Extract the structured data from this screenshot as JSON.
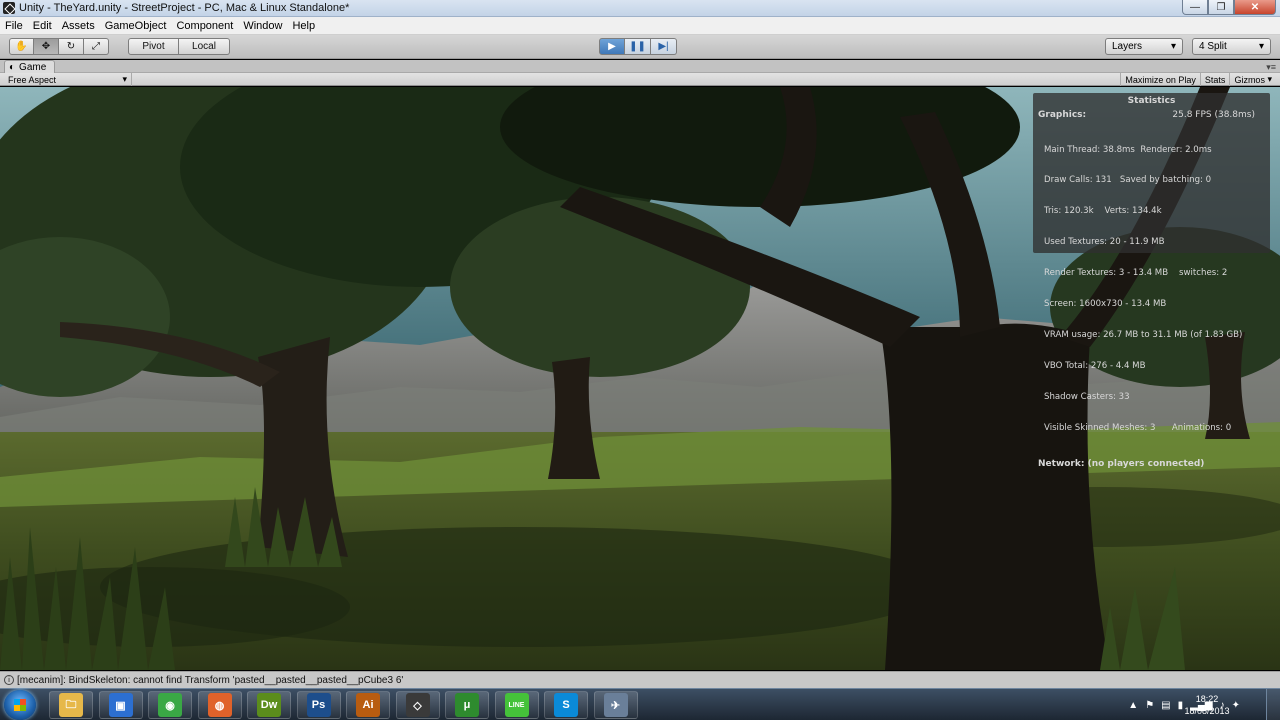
{
  "window": {
    "title": "Unity - TheYard.unity - StreetProject - PC, Mac & Linux Standalone*",
    "controls": {
      "minimize": "—",
      "maximize": "❐",
      "close": "✕"
    }
  },
  "menu": [
    "File",
    "Edit",
    "Assets",
    "GameObject",
    "Component",
    "Window",
    "Help"
  ],
  "toolbar": {
    "tools": [
      {
        "name": "hand-icon",
        "glyph": "✋"
      },
      {
        "name": "move-icon",
        "glyph": "✥"
      },
      {
        "name": "rotate-icon",
        "glyph": "↻"
      },
      {
        "name": "scale-icon",
        "glyph": "⤢"
      }
    ],
    "pivot_label": "Pivot",
    "local_label": "Local",
    "play": {
      "play": "▶",
      "pause": "❚❚",
      "step": "▶|"
    },
    "layers_label": "Layers",
    "layout_label": "4 Split"
  },
  "game_panel": {
    "tab_label": "Game",
    "aspect_label": "Free Aspect",
    "maximize_label": "Maximize on Play",
    "stats_label": "Stats",
    "gizmos_label": "Gizmos"
  },
  "statistics": {
    "title": "Statistics",
    "graphics_label": "Graphics:",
    "fps": "25.8 FPS (38.8ms)",
    "lines": [
      "Main Thread: 38.8ms  Renderer: 2.0ms",
      "Draw Calls: 131   Saved by batching: 0",
      "Tris: 120.3k    Verts: 134.4k",
      "Used Textures: 20 - 11.9 MB",
      "Render Textures: 3 - 13.4 MB    switches: 2",
      "Screen: 1600x730 - 13.4 MB",
      "VRAM usage: 26.7 MB to 31.1 MB (of 1.83 GB)",
      "VBO Total: 276 - 4.4 MB",
      "Shadow Casters: 33",
      "Visible Skinned Meshes: 3      Animations: 0"
    ],
    "network": "Network: (no players connected)"
  },
  "console_message": "[mecanim]: BindSkeleton: cannot find Transform 'pasted__pasted__pasted__pCube3 6'",
  "taskbar": {
    "apps": [
      {
        "name": "explorer",
        "glyph": "🗀",
        "color": "#e6b84a"
      },
      {
        "name": "app-blue",
        "glyph": "▣",
        "color": "#2c6fd1"
      },
      {
        "name": "chrome",
        "glyph": "◉",
        "color": "#3aa845"
      },
      {
        "name": "firefox",
        "glyph": "◍",
        "color": "#e0622a"
      },
      {
        "name": "dreamweaver",
        "glyph": "Dw",
        "color": "#5b8d1c"
      },
      {
        "name": "photoshop",
        "glyph": "Ps",
        "color": "#1d4e8c"
      },
      {
        "name": "illustrator",
        "glyph": "Ai",
        "color": "#b85c10"
      },
      {
        "name": "unity",
        "glyph": "◇",
        "color": "#3a3a3a"
      },
      {
        "name": "utorrent",
        "glyph": "μ",
        "color": "#2e8b2e"
      },
      {
        "name": "line",
        "glyph": "LINE",
        "color": "#45c23a"
      },
      {
        "name": "skype",
        "glyph": "S",
        "color": "#0a8ad8"
      },
      {
        "name": "app-misc",
        "glyph": "✈",
        "color": "#6a7f99"
      }
    ],
    "clock_time": "18:22",
    "clock_date": "18/08/2013"
  },
  "colors": {
    "play_active": "#3f78b8",
    "stats_bg": "#303030"
  }
}
